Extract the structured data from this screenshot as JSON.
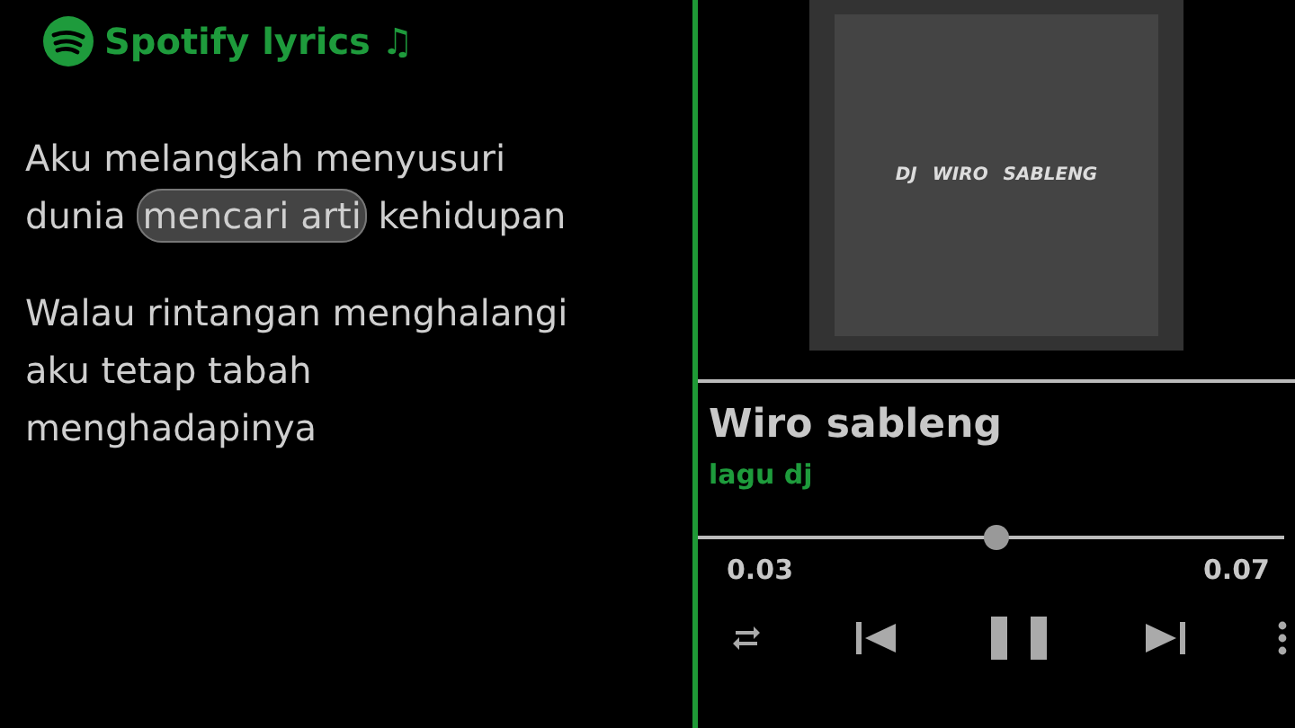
{
  "header": {
    "title": "Spotify lyrics",
    "notes": "♫"
  },
  "lyrics": [
    {
      "lines": [
        [
          {
            "text": "Aku melangkah menyusuri",
            "highlighted": false
          }
        ],
        [
          {
            "text": "dunia ",
            "highlighted": false
          },
          {
            "text": "mencari arti",
            "highlighted": true
          },
          {
            "text": " kehidupan",
            "highlighted": false
          }
        ]
      ]
    },
    {
      "lines": [
        [
          {
            "text": "Walau rintangan menghalangi",
            "highlighted": false
          }
        ],
        [
          {
            "text": "aku tetap tabah",
            "highlighted": false
          }
        ],
        [
          {
            "text": "menghadapinya",
            "highlighted": false
          }
        ]
      ]
    }
  ],
  "player": {
    "cover_text": "DJ WIRO SABLENG",
    "title": "Wiro sableng",
    "artist": "lagu dj",
    "progress": {
      "level": 0.51
    },
    "elapsed": "0.03",
    "duration": "0.07",
    "playing": true
  }
}
